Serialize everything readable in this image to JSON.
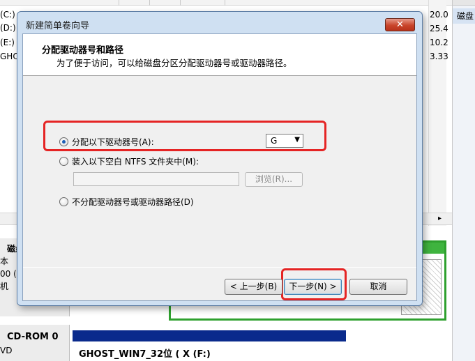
{
  "background": {
    "volumes": [
      "(C:)",
      "(D:)",
      "(E:)",
      "GHOS"
    ],
    "capacities": [
      "20.0",
      "25.4",
      "10.2",
      "3.33"
    ],
    "action_item": "磁盘",
    "disk0_lines": [
      "磁盘",
      "本",
      "00 (",
      "机"
    ],
    "cdrom_label": "CD-ROM 0",
    "cdrom_sub": "VD",
    "cdrom_volume": "GHOST_WIN7_32位 ( X  (F:)",
    "colors": {
      "partition_green": "#3fb43f",
      "cdrom_bar": "#0a2a8c"
    }
  },
  "dialog": {
    "title": "新建简单卷向导",
    "close_glyph": "✕",
    "header_title": "分配驱动器号和路径",
    "header_subtitle": "为了便于访问，可以给磁盘分区分配驱动器号或驱动器路径。",
    "option_assign": "分配以下驱动器号(A):",
    "drive_letter": "G",
    "option_mount": "装入以下空白 NTFS 文件夹中(M):",
    "browse_label": "浏览(R)...",
    "option_none": "不分配驱动器号或驱动器路径(D)",
    "back_label": "< 上一步(B)",
    "next_label": "下一步(N) >",
    "cancel_label": "取消",
    "selected_option": "assign",
    "highlight_color": "#e52424"
  }
}
